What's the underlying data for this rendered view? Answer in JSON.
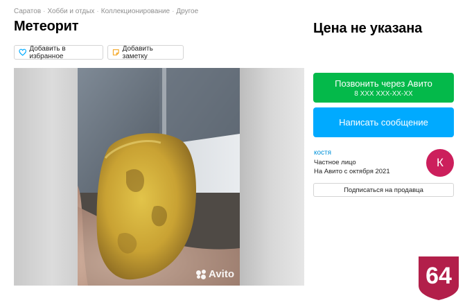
{
  "breadcrumb": [
    "Саратов",
    "Хобби и отдых",
    "Коллекционирование",
    "Другое"
  ],
  "breadcrumb_separator": "·",
  "title": "Метеорит",
  "price": "Цена не указана",
  "actions": {
    "favorite_label": "Добавить в избранное",
    "note_label": "Добавить заметку"
  },
  "gallery": {
    "watermark": "Avito"
  },
  "contact": {
    "call_label": "Позвонить через Авито",
    "phone_masked": "8 XXX XXX-XX-XX",
    "message_label": "Написать сообщение"
  },
  "seller": {
    "name": "костя",
    "type": "Частное лицо",
    "since": "На Авито с октября 2021",
    "avatar_letter": "К",
    "subscribe_label": "Подписаться на продавца"
  },
  "region_badge": "64",
  "colors": {
    "call_button": "#04b94a",
    "message_button": "#00aaff",
    "avatar": "#cc1f5c",
    "badge": "#b21f4a",
    "link": "#0091d9"
  }
}
